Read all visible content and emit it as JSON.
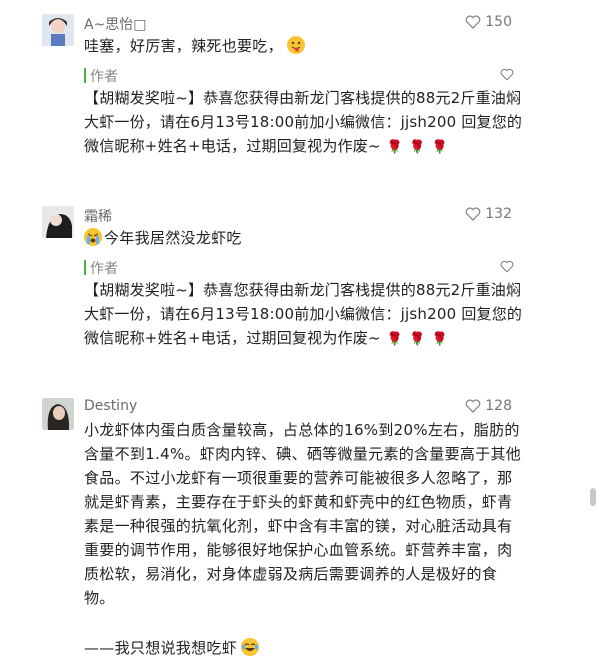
{
  "comments": [
    {
      "username": "A~思怡□",
      "likes": "150",
      "text": "哇塞，好厉害，辣死也要吃，",
      "emoji": "tongue-face",
      "reply": {
        "author": "作者",
        "text": "【胡糊发奖啦~】恭喜您获得由新龙门客栈提供的88元2斤重油焖大虾一份，请在6月13号18:00前加小编微信：jjsh200 回复您的微信昵称+姓名+电话，过期回复视为作废~"
      }
    },
    {
      "username": "霜稀",
      "likes": "132",
      "text": "今年我居然没龙虾吃",
      "emoji": "crying-face",
      "reply": {
        "author": "作者",
        "text": "【胡糊发奖啦~】恭喜您获得由新龙门客栈提供的88元2斤重油焖大虾一份，请在6月13号18:00前加小编微信：jjsh200 回复您的微信昵称+姓名+电话，过期回复视为作废~"
      }
    },
    {
      "username": "Destiny",
      "likes": "128",
      "text": "小龙虾体内蛋白质含量较高，占总体的16%到20%左右，脂肪的含量不到1.4%。虾肉内锌、碘、硒等微量元素的含量要高于其他食品。不过小龙虾有一项很重要的营养可能被很多人忽略了，那就是虾青素，主要存在于虾头的虾黄和虾壳中的红色物质，虾青素是一种很强的抗氧化剂，虾中含有丰富的镁，对心脏活动具有重要的调节作用，能够很好地保护心血管系统。虾营养丰富，肉质松软，易消化，对身体虚弱及病后需要调养的人是极好的食物。"
    }
  ],
  "bottom_text": "——我只想说我想吃虾",
  "bottom_emoji": "laughing-tears-face",
  "colors": {
    "reply_bar": "#4cae4c",
    "rose": "#d22222"
  }
}
